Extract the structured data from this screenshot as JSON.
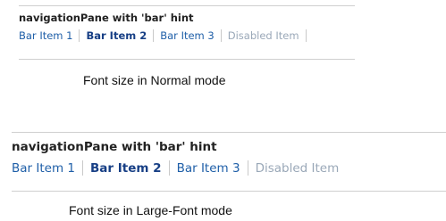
{
  "normal_mode": {
    "pane_title": "navigationPane with 'bar' hint",
    "items": [
      {
        "label": "Bar Item 1",
        "state": "normal"
      },
      {
        "label": "Bar Item 2",
        "state": "selected"
      },
      {
        "label": "Bar Item 3",
        "state": "normal"
      },
      {
        "label": "Disabled Item",
        "state": "disabled"
      }
    ],
    "caption": "Font size in Normal mode"
  },
  "large_font_mode": {
    "pane_title": "navigationPane with 'bar' hint",
    "items": [
      {
        "label": "Bar Item 1",
        "state": "normal"
      },
      {
        "label": "Bar Item 2",
        "state": "selected"
      },
      {
        "label": "Bar Item 3",
        "state": "normal"
      },
      {
        "label": "Disabled Item",
        "state": "disabled"
      }
    ],
    "caption": "Font size in Large-Font mode"
  },
  "colors": {
    "link": "#1f5fa8",
    "selected": "#173f85",
    "disabled": "#9aa8b8",
    "separator": "#c9c9c9",
    "rule": "#cfcfcf"
  }
}
